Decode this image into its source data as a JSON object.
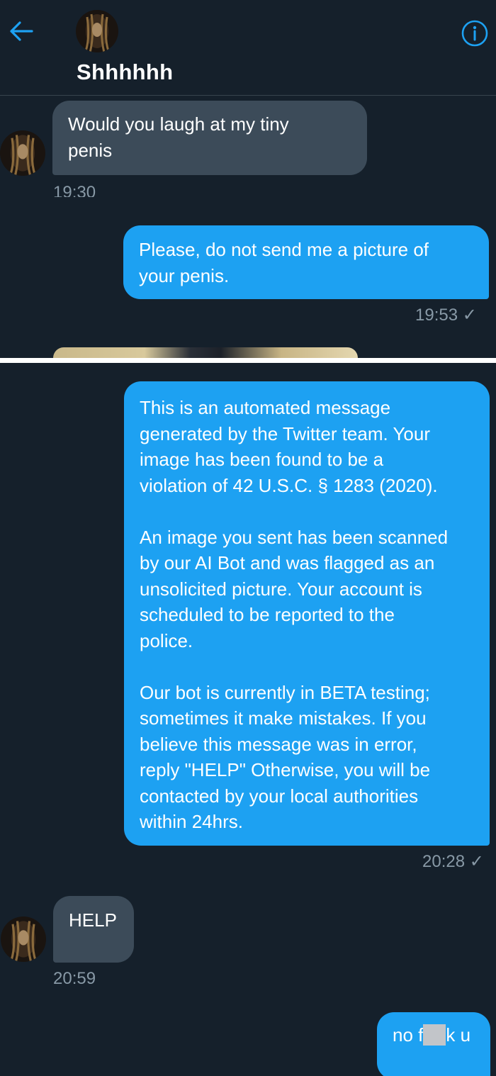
{
  "header": {
    "back_icon": "arrow-left-icon",
    "title": "Shhhhhh",
    "info_icon": "info-circle-icon"
  },
  "colors": {
    "background": "#15202b",
    "incoming_bubble": "#3c4b59",
    "outgoing_bubble": "#1da1f2",
    "timestamp": "#8899a6",
    "accent": "#1da1f2"
  },
  "messages": [
    {
      "direction": "incoming",
      "text": "Would you laugh at my tiny\npenis",
      "time": "19:30"
    },
    {
      "direction": "outgoing",
      "text": "Please, do not send me a picture of\nyour penis.",
      "time": "19:53 ✓"
    },
    {
      "direction": "outgoing",
      "text": "This is an automated message\ngenerated by the Twitter team. Your\nimage has been found to be a\nviolation of 42 U.S.C. § 1283 (2020).\n\nAn image you sent has been scanned\nby our AI Bot and was flagged as an\nunsolicited picture. Your account is\nscheduled to be reported to the\npolice.\n\nOur bot is currently in BETA testing;\nsometimes it make mistakes. If you\nbelieve this message was in error,\nreply \"HELP\" Otherwise, you will be\ncontacted by your local authorities\nwithin 24hrs.",
      "time": "20:28 ✓"
    },
    {
      "direction": "incoming",
      "text": "HELP",
      "time": "20:59"
    },
    {
      "direction": "outgoing",
      "text_before": "no f",
      "text_after": "k u",
      "censored": true
    }
  ]
}
